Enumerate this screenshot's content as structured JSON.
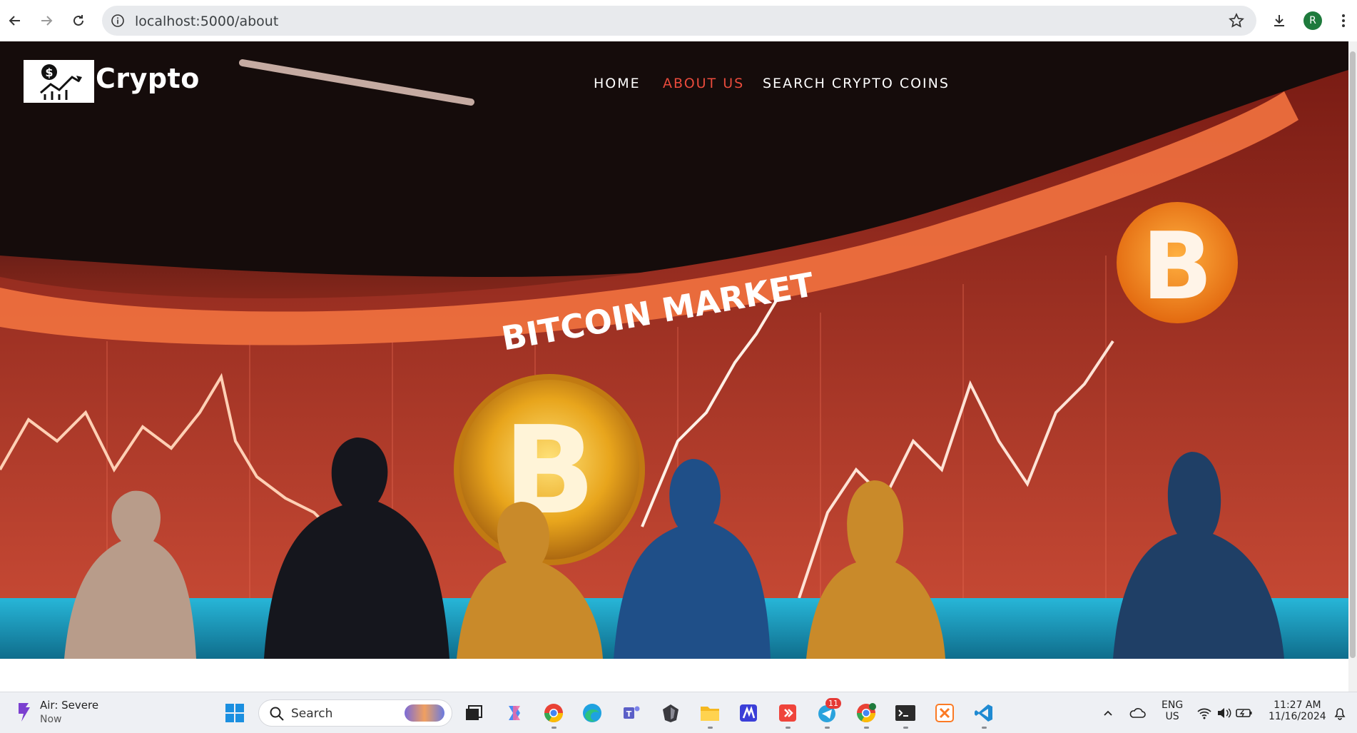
{
  "browser": {
    "url": "localhost:5000/about",
    "profile_initial": "R"
  },
  "site": {
    "brand": "Crypto",
    "nav": [
      {
        "label": "HOME",
        "active": false
      },
      {
        "label": "ABOUT US",
        "active": true
      },
      {
        "label": "SEARCH CRYPTO COINS",
        "active": false
      }
    ],
    "hero_banner_text": "BITCOIN MARKET",
    "accent_color": "#e94b3c"
  },
  "taskbar": {
    "weather_title": "Air: Severe",
    "weather_sub": "Now",
    "search_label": "Search",
    "telegram_badge": "11",
    "lang_top": "ENG",
    "lang_bottom": "US",
    "time": "11:27 AM",
    "date": "11/16/2024",
    "apps": [
      "windows-start",
      "search",
      "task-view",
      "copilot",
      "chrome",
      "edge",
      "teams",
      "obsidian",
      "file-explorer",
      "app-m",
      "anydesk",
      "telegram",
      "chrome-profile",
      "terminal",
      "xampp",
      "vscode"
    ]
  }
}
